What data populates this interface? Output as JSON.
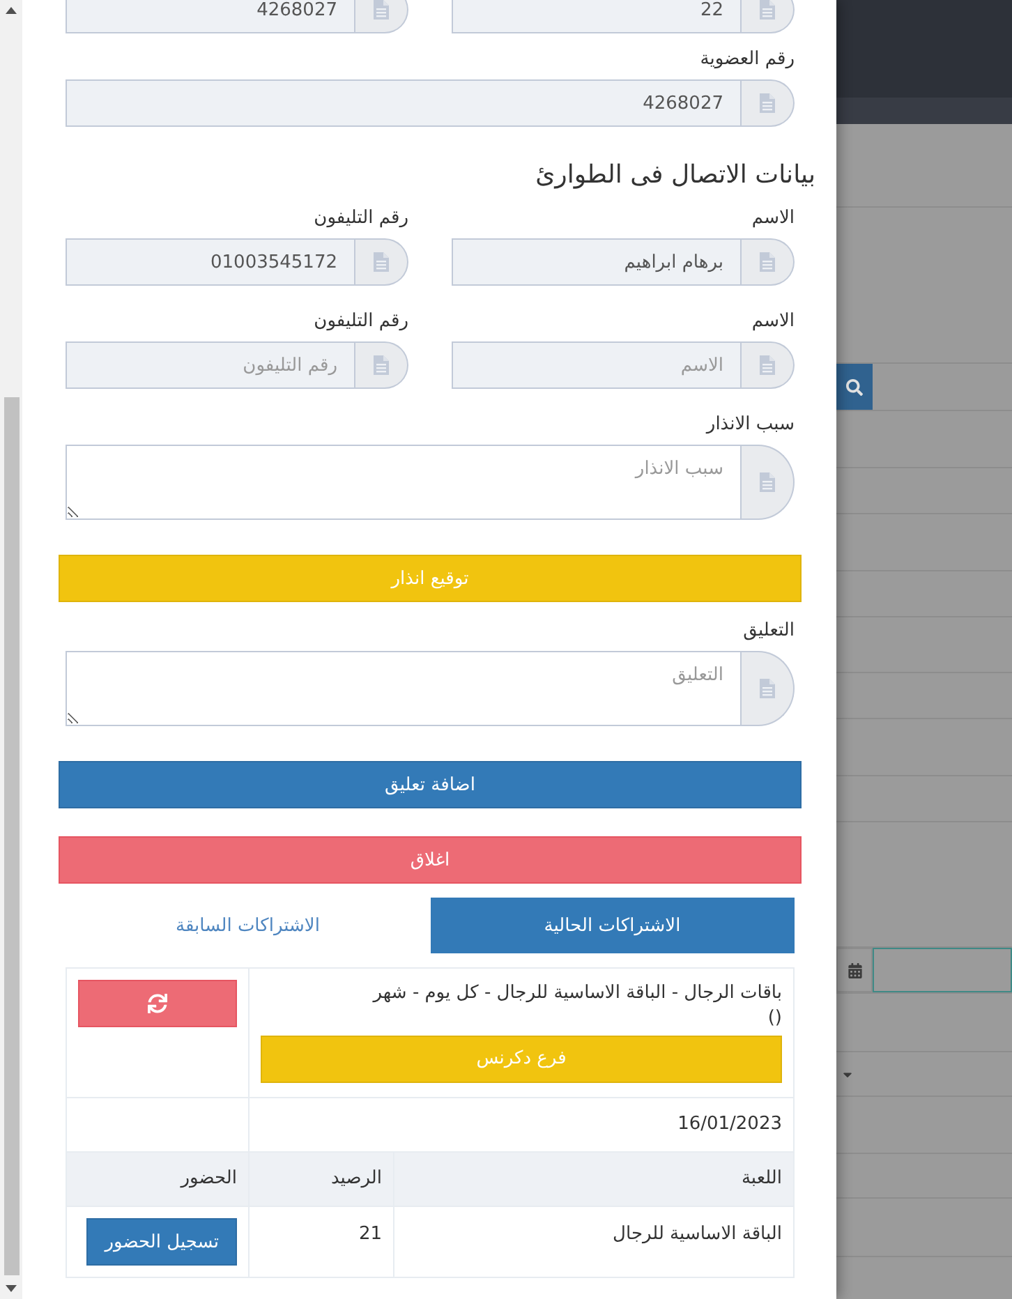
{
  "top_fields": [
    {
      "value": "22"
    },
    {
      "value": "4268027"
    }
  ],
  "membership": {
    "label": "رقم العضوية",
    "value": "4268027"
  },
  "emergency_contacts": {
    "title": "بيانات الاتصال فى الطوارئ",
    "rows": [
      {
        "fields": [
          {
            "label": "الاسم",
            "value": "برهام ابراهيم"
          },
          {
            "label": "رقم التليفون",
            "value": "01003545172"
          }
        ]
      },
      {
        "fields": [
          {
            "label": "الاسم",
            "placeholder": "الاسم"
          },
          {
            "label": "رقم التليفون",
            "placeholder": "رقم التليفون"
          }
        ]
      }
    ]
  },
  "warning": {
    "label": "سبب الانذار",
    "placeholder": "سبب الانذار",
    "button": "توقيع انذار"
  },
  "comment": {
    "label": "التعليق",
    "placeholder": "التعليق",
    "button": "اضافة تعليق"
  },
  "close_button": "اغلاق",
  "tabs": [
    {
      "label": "الاشتراكات الحالية",
      "selected": true
    },
    {
      "label": "الاشتراكات السابقة",
      "selected": false
    }
  ],
  "subscription": {
    "description": "باقات الرجال - الباقة الاساسية للرجال - كل يوم - شهر\n()",
    "branch": "فرع دكرنس",
    "date": "16/01/2023",
    "table": {
      "columns": [
        "اللعبة",
        "الرصيد",
        "الحضور"
      ],
      "rows": [
        {
          "cells": [
            "الباقة الاساسية للرجال",
            "21"
          ],
          "button": "تسجيل الحضور"
        }
      ]
    }
  }
}
